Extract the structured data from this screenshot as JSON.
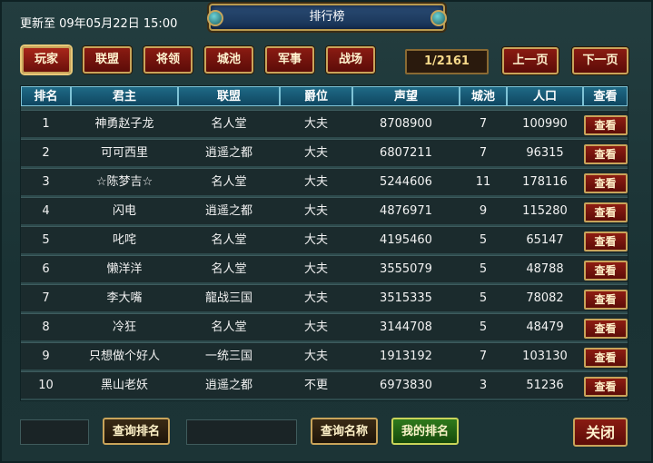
{
  "header": {
    "update_text": "更新至 09年05月22日 15:00",
    "title": "排行榜"
  },
  "tabs": [
    {
      "label": "玩家",
      "active": true
    },
    {
      "label": "联盟",
      "active": false
    },
    {
      "label": "将领",
      "active": false
    },
    {
      "label": "城池",
      "active": false
    },
    {
      "label": "军事",
      "active": false
    },
    {
      "label": "战场",
      "active": false
    }
  ],
  "pagination": {
    "page_text": "1/2161",
    "prev_label": "上一页",
    "next_label": "下一页"
  },
  "table": {
    "columns": [
      "排名",
      "君主",
      "联盟",
      "爵位",
      "声望",
      "城池",
      "人口",
      "查看"
    ],
    "rows": [
      {
        "rank": "1",
        "lord": "神勇赵子龙",
        "alliance": "名人堂",
        "title": "大夫",
        "prestige": "8708900",
        "cities": "7",
        "population": "100990",
        "view": "查看"
      },
      {
        "rank": "2",
        "lord": "可可西里",
        "alliance": "逍遥之都",
        "title": "大夫",
        "prestige": "6807211",
        "cities": "7",
        "population": "96315",
        "view": "查看"
      },
      {
        "rank": "3",
        "lord": "☆陈梦吉☆",
        "alliance": "名人堂",
        "title": "大夫",
        "prestige": "5244606",
        "cities": "11",
        "population": "178116",
        "view": "查看"
      },
      {
        "rank": "4",
        "lord": "闪电",
        "alliance": "逍遥之都",
        "title": "大夫",
        "prestige": "4876971",
        "cities": "9",
        "population": "115280",
        "view": "查看"
      },
      {
        "rank": "5",
        "lord": "叱咤",
        "alliance": "名人堂",
        "title": "大夫",
        "prestige": "4195460",
        "cities": "5",
        "population": "65147",
        "view": "查看"
      },
      {
        "rank": "6",
        "lord": "懒洋洋",
        "alliance": "名人堂",
        "title": "大夫",
        "prestige": "3555079",
        "cities": "5",
        "population": "48788",
        "view": "查看"
      },
      {
        "rank": "7",
        "lord": "李大嘴",
        "alliance": "龍战三国",
        "title": "大夫",
        "prestige": "3515335",
        "cities": "5",
        "population": "78082",
        "view": "查看"
      },
      {
        "rank": "8",
        "lord": "冷狂",
        "alliance": "名人堂",
        "title": "大夫",
        "prestige": "3144708",
        "cities": "5",
        "population": "48479",
        "view": "查看"
      },
      {
        "rank": "9",
        "lord": "只想做个好人",
        "alliance": "一统三国",
        "title": "大夫",
        "prestige": "1913192",
        "cities": "7",
        "population": "103130",
        "view": "查看"
      },
      {
        "rank": "10",
        "lord": "黑山老妖",
        "alliance": "逍遥之都",
        "title": "不更",
        "prestige": "6973830",
        "cities": "3",
        "population": "51236",
        "view": "查看"
      }
    ]
  },
  "footer": {
    "rank_input_value": "",
    "query_rank_label": "查询排名",
    "name_input_value": "",
    "query_name_label": "查询名称",
    "my_rank_label": "我的排名",
    "close_label": "关闭"
  }
}
